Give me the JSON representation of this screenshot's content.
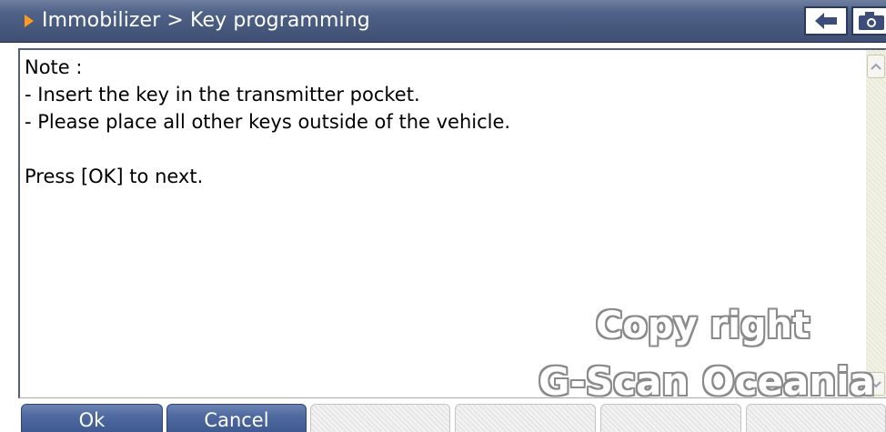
{
  "header": {
    "title": "Immobilizer > Key programming",
    "back_icon": "back-arrow-icon",
    "camera_icon": "camera-icon"
  },
  "message": {
    "lines": [
      "Note :",
      "- Insert the key in the transmitter pocket.",
      "- Please place all other keys outside of the vehicle.",
      "",
      "Press [OK] to next."
    ]
  },
  "watermark": {
    "line1": "Copy right",
    "line2": "G-Scan Oceania"
  },
  "buttons": {
    "ok": "Ok",
    "cancel": "Cancel",
    "empty": [
      "",
      "",
      "",
      ""
    ]
  },
  "colors": {
    "title_bar": "#4f6287",
    "title_arrow": "#ff9a1e",
    "active_button": "#4f6aa0"
  }
}
